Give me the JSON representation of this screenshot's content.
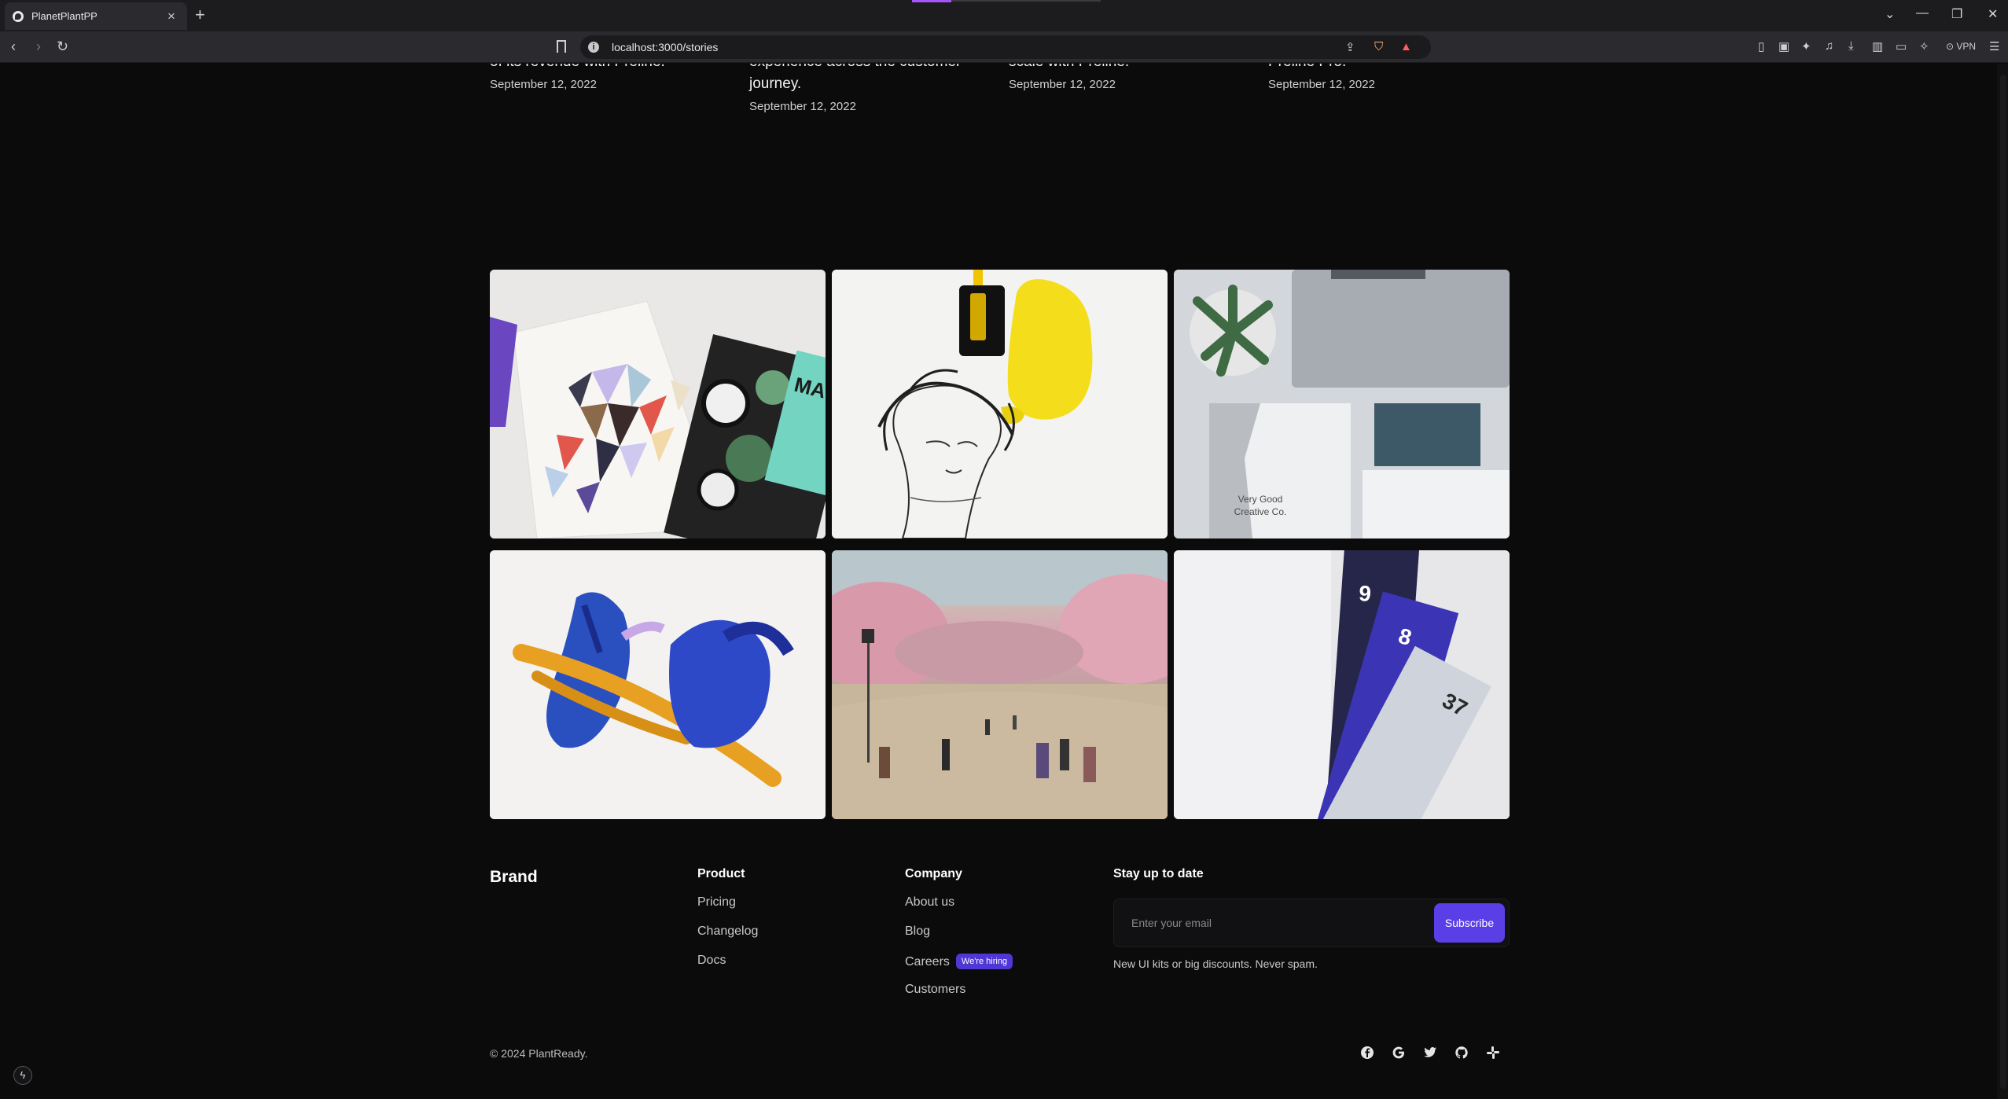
{
  "browser": {
    "tab_title": "PlanetPlantPP",
    "tab_close": "×",
    "new_tab": "+",
    "url": "localhost:3000/stories",
    "vpn_label": "VPN"
  },
  "stories": [
    {
      "snippet_lines": [
        "of its revenue with Preline."
      ],
      "date": "September 12, 2022"
    },
    {
      "snippet_lines": [
        "experience across the customer",
        "journey."
      ],
      "date": "September 12, 2022"
    },
    {
      "snippet_lines": [
        "scale with Preline."
      ],
      "date": "September 12, 2022"
    },
    {
      "snippet_lines": [
        "Preline Pro."
      ],
      "date": "September 12, 2022"
    }
  ],
  "gallery": {
    "tile3_text": "Very Good\nCreative Co.",
    "tile6_numbers": [
      "9",
      "8",
      "37"
    ]
  },
  "footer": {
    "brand": "Brand",
    "product": {
      "heading": "Product",
      "links": [
        "Pricing",
        "Changelog",
        "Docs"
      ]
    },
    "company": {
      "heading": "Company",
      "links": [
        "About us",
        "Blog",
        "Careers",
        "Customers"
      ],
      "badge": "We're hiring"
    },
    "newsletter": {
      "heading": "Stay up to date",
      "placeholder": "Enter your email",
      "button": "Subscribe",
      "note": "New UI kits or big discounts. Never spam."
    },
    "copyright": "© 2024 PlantReady.",
    "social_icons": [
      "facebook-icon",
      "google-icon",
      "twitter-icon",
      "github-icon",
      "slack-icon"
    ]
  },
  "colors": {
    "accent": "#5b3fe6",
    "background": "#0b0b0c"
  }
}
